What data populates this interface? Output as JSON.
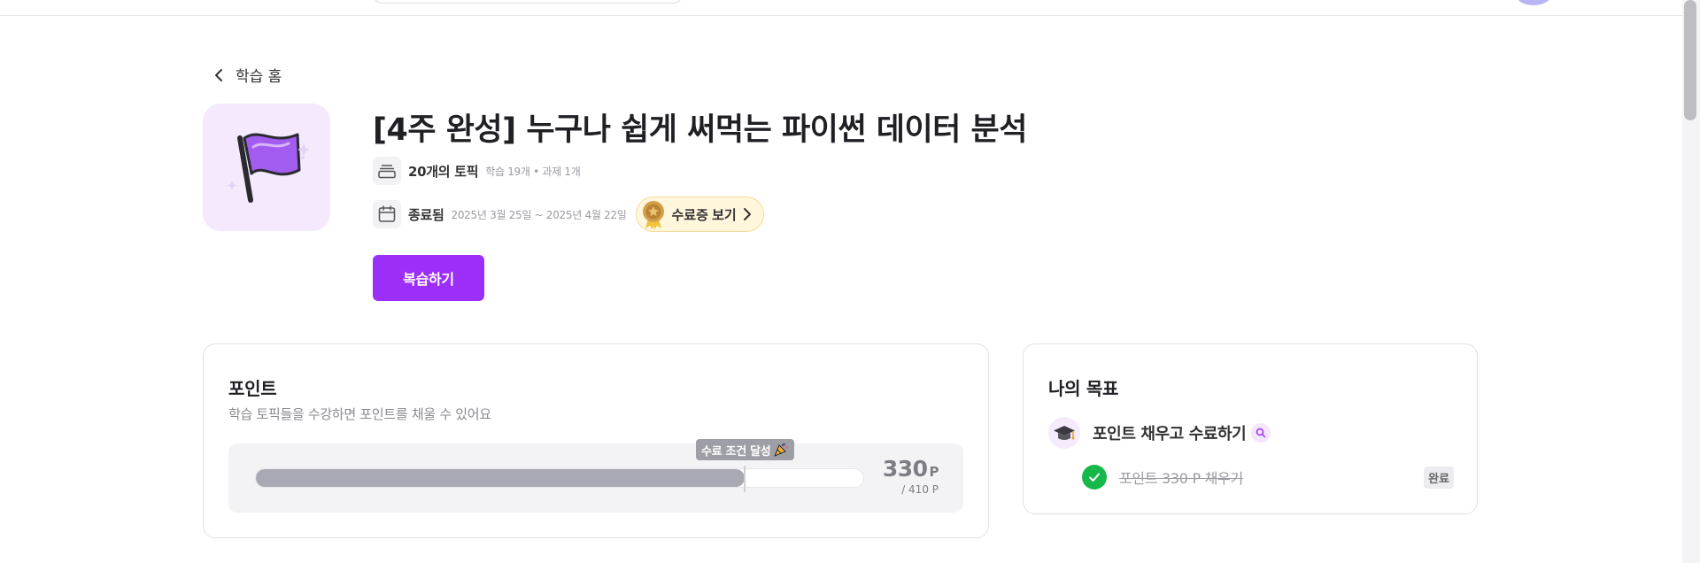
{
  "back_link": {
    "label": "학습 홈"
  },
  "course": {
    "title": "[4주 완성] 누구나 쉽게 써먹는 파이썬 데이터 분석",
    "topics_label": "20개의 토픽",
    "topics_detail": "학습 19개 • 과제 1개",
    "status_label": "종료됨",
    "period": "2025년 3월 25일 ~ 2025년 4월 22일",
    "certificate_label": "수료증 보기",
    "review_button": "복습하기",
    "icon": "flag-icon"
  },
  "points": {
    "title": "포인트",
    "subtitle": "학습 토픽들을 수강하면 포인트를 채울 수 있어요",
    "goal_badge": "수료 조건 달성",
    "current": "330",
    "unit": "P",
    "max_label": "/ 410 P",
    "current_value": 330,
    "max_value": 410,
    "goal_value": 330
  },
  "goal": {
    "title": "나의 목표",
    "item_label": "포인트 채우고 수료하기",
    "sub_label": "포인트 330 P 채우기",
    "done_label": "완료"
  },
  "colors": {
    "accent": "#9b2ff8",
    "success": "#16b84a",
    "progress": "#a9a9b3"
  }
}
